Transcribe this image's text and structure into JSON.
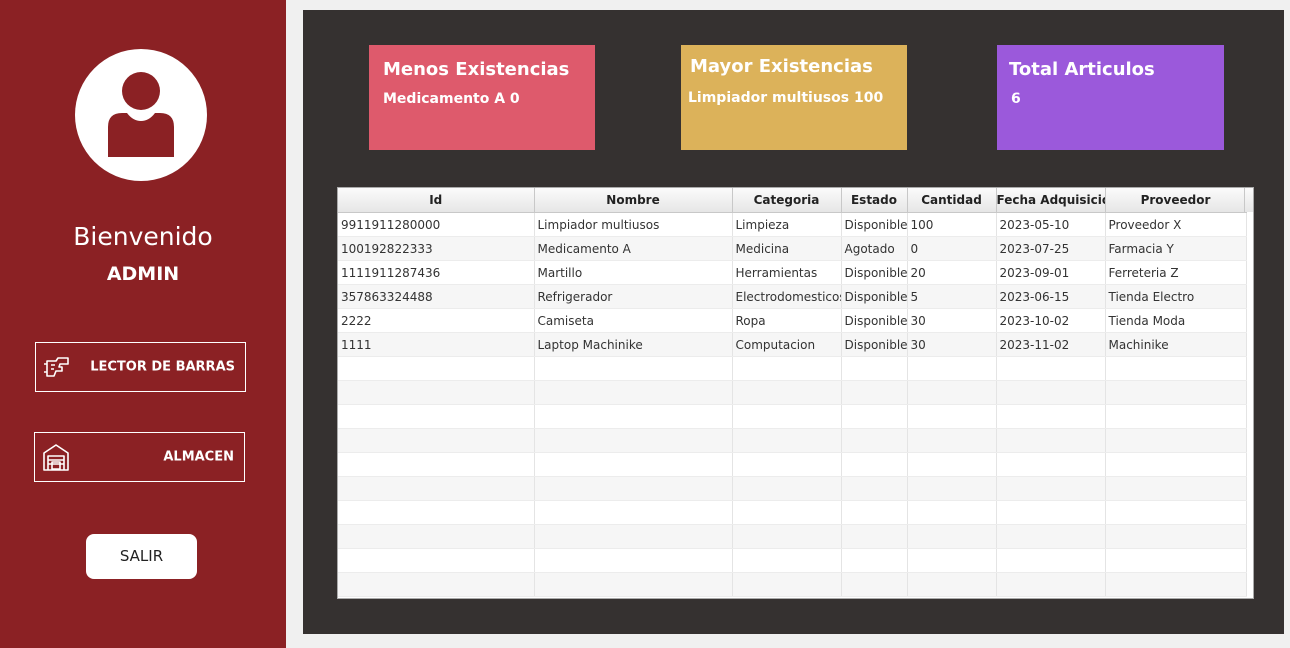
{
  "sidebar": {
    "welcome": "Bienvenido",
    "username": "ADMIN",
    "buttons": {
      "scanner": "LECTOR DE BARRAS",
      "warehouse": "ALMACEN",
      "exit": "SALIR"
    },
    "icons": {
      "avatar": "user-avatar-icon",
      "scanner": "barcode-scanner-icon",
      "warehouse": "warehouse-icon"
    },
    "color": "#8b2124"
  },
  "cards": {
    "min_stock": {
      "title": "Menos Existencias",
      "value": "Medicamento A 0",
      "color": "#de5a6c"
    },
    "max_stock": {
      "title": "Mayor Existencias",
      "value": "Limpiador multiusos 100",
      "color": "#dcb25a"
    },
    "total": {
      "title": "Total Articulos",
      "value": "6",
      "color": "#9b59db"
    }
  },
  "table": {
    "columns": [
      "Id",
      "Nombre",
      "Categoria",
      "Estado",
      "Cantidad",
      "Fecha Adquisicion",
      "Proveedor"
    ],
    "rows": [
      [
        "9911911280000",
        "Limpiador multiusos",
        "Limpieza",
        "Disponible",
        "100",
        "2023-05-10",
        "Proveedor X"
      ],
      [
        "100192822333",
        "Medicamento A",
        "Medicina",
        "Agotado",
        "0",
        "2023-07-25",
        "Farmacia Y"
      ],
      [
        "1111911287436",
        "Martillo",
        "Herramientas",
        "Disponible",
        "20",
        "2023-09-01",
        "Ferreteria Z"
      ],
      [
        "357863324488",
        "Refrigerador",
        "Electrodomesticos",
        "Disponible",
        "5",
        "2023-06-15",
        "Tienda Electro"
      ],
      [
        "2222",
        "Camiseta",
        "Ropa",
        "Disponible",
        "30",
        "2023-10-02",
        "Tienda Moda"
      ],
      [
        "1111",
        "Laptop Machinike",
        "Computacion",
        "Disponible",
        "30",
        "2023-11-02",
        "Machinike"
      ]
    ]
  }
}
